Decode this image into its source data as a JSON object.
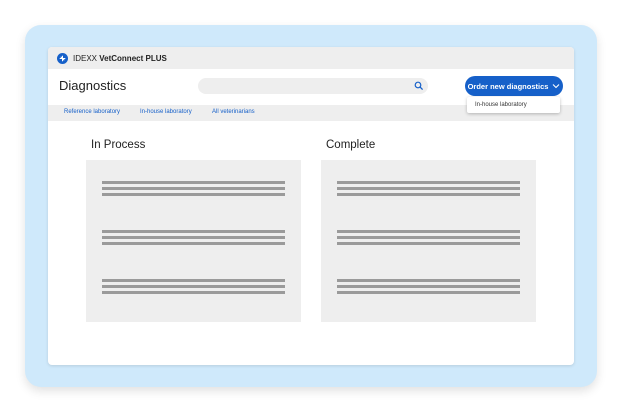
{
  "app": {
    "brand": "IDEXX",
    "product": "VetConnect PLUS"
  },
  "header": {
    "page_title": "Diagnostics",
    "search_placeholder": "",
    "order_button_label": "Order new diagnostics",
    "dropdown_item": "In-house laboratory"
  },
  "tabs": [
    {
      "label": "Reference laboratory"
    },
    {
      "label": "In-house laboratory"
    },
    {
      "label": "All veterinarians"
    }
  ],
  "columns": [
    {
      "title": "In Process"
    },
    {
      "title": "Complete"
    }
  ],
  "colors": {
    "accent": "#1660c9",
    "frame": "#cfe9fb",
    "bar": "#eeeeee",
    "placeholder_line": "#9a9a9a"
  }
}
